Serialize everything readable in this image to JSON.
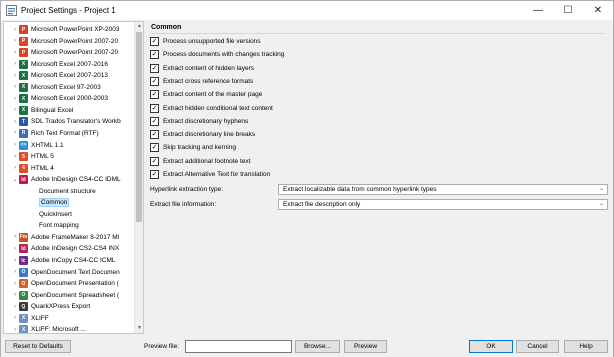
{
  "window": {
    "title": "Project Settings - Project 1",
    "controls": [
      "—",
      "☐",
      "✕"
    ]
  },
  "tree": {
    "items": [
      {
        "label": "Microsoft PowerPoint XP-2003",
        "icon": "P",
        "color": "#d24726",
        "level": 1,
        "exp": "›"
      },
      {
        "label": "Microsoft PowerPoint 2007-20",
        "icon": "P",
        "color": "#d24726",
        "level": 1,
        "exp": "›"
      },
      {
        "label": "Microsoft PowerPoint 2007-20",
        "icon": "P",
        "color": "#d24726",
        "level": 1,
        "exp": "›"
      },
      {
        "label": "Microsoft Excel 2007-2016",
        "icon": "X",
        "color": "#1d7044",
        "level": 1,
        "exp": "›"
      },
      {
        "label": "Microsoft Excel 2007-2013",
        "icon": "X",
        "color": "#1d7044",
        "level": 1,
        "exp": "›"
      },
      {
        "label": "Microsoft Excel 97-2003",
        "icon": "X",
        "color": "#1d7044",
        "level": 1,
        "exp": "›"
      },
      {
        "label": "Microsoft Excel 2000-2003",
        "icon": "X",
        "color": "#1d7044",
        "level": 1,
        "exp": "›"
      },
      {
        "label": "Bilingual Excel",
        "icon": "X",
        "color": "#1d7044",
        "level": 1,
        "exp": "›"
      },
      {
        "label": "SDL Trados Translator's Workb",
        "icon": "T",
        "color": "#2a5aa6",
        "level": 1,
        "exp": "›"
      },
      {
        "label": "Rich Text Format (RTF)",
        "icon": "R",
        "color": "#3d6fb4",
        "level": 1,
        "exp": "›"
      },
      {
        "label": "XHTML 1.1",
        "icon": "<>",
        "color": "#2f8fd8",
        "level": 1,
        "exp": "›"
      },
      {
        "label": "HTML 5",
        "icon": "5",
        "color": "#e44d26",
        "level": 1,
        "exp": "›"
      },
      {
        "label": "HTML 4",
        "icon": "4",
        "color": "#e44d26",
        "level": 1,
        "exp": "›"
      },
      {
        "label": "Adobe InDesign CS4-CC IDML",
        "icon": "Id",
        "color": "#c2185b",
        "level": 1,
        "exp": "⌄"
      },
      {
        "label": "Document structure",
        "icon": "",
        "color": "",
        "level": 2,
        "exp": ""
      },
      {
        "label": "Common",
        "icon": "",
        "color": "",
        "level": 2,
        "exp": "",
        "selected": true
      },
      {
        "label": "QuickInsert",
        "icon": "",
        "color": "",
        "level": 2,
        "exp": ""
      },
      {
        "label": "Font mapping",
        "icon": "",
        "color": "",
        "level": 2,
        "exp": ""
      },
      {
        "label": "Adobe FrameMaker 8-2017 MI",
        "icon": "Fm",
        "color": "#c9521f",
        "level": 1,
        "exp": "›"
      },
      {
        "label": "Adobe InDesign CS2-CS4 INX",
        "icon": "Id",
        "color": "#b5235c",
        "level": 1,
        "exp": "›"
      },
      {
        "label": "Adobe InCopy CS4-CC ICML",
        "icon": "Ic",
        "color": "#6f2b8a",
        "level": 1,
        "exp": "›"
      },
      {
        "label": "OpenDocument Text Documen",
        "icon": "O",
        "color": "#3b7ac6",
        "level": 1,
        "exp": "›"
      },
      {
        "label": "OpenDocument Presentation (",
        "icon": "O",
        "color": "#d3622a",
        "level": 1,
        "exp": "›"
      },
      {
        "label": "OpenDocument Spreadsheet (",
        "icon": "O",
        "color": "#2e8b3f",
        "level": 1,
        "exp": "›"
      },
      {
        "label": "QuarkXPress Export",
        "icon": "Q",
        "color": "#3c3c3c",
        "level": 1,
        "exp": "›"
      },
      {
        "label": "XLIFF",
        "icon": "X",
        "color": "#6f8fbf",
        "level": 1,
        "exp": "›"
      },
      {
        "label": "XLIFF: Microsoft ...",
        "icon": "X",
        "color": "#6f8fbf",
        "level": 1,
        "exp": "›"
      }
    ]
  },
  "panel": {
    "heading": "Common",
    "checkboxes": [
      {
        "label": "Process unsupported file versions",
        "checked": true
      },
      {
        "label": "Process documents with changes tracking",
        "checked": true
      },
      {
        "label": "Extract content of hidden layers",
        "checked": true
      },
      {
        "label": "Extract cross reference formats",
        "checked": true
      },
      {
        "label": "Extract content of the master page",
        "checked": true
      },
      {
        "label": "Extract hidden conditional text content",
        "checked": true
      },
      {
        "label": "Extract discretionary hyphens",
        "checked": true
      },
      {
        "label": "Extract discretionary line breaks",
        "checked": true
      },
      {
        "label": "Skip tracking and kerning",
        "checked": true
      },
      {
        "label": "Extract additional footnote text",
        "checked": true
      },
      {
        "label": "Extract Alternative Text for translation",
        "checked": true
      }
    ],
    "hyperlink_label": "Hyperlink extraction type:",
    "hyperlink_value": "Extract localizable data from common hyperlink types",
    "fileinfo_label": "Extract file information:",
    "fileinfo_value": "Extract file description only"
  },
  "bottom": {
    "reset_label": "Reset to Defaults",
    "preview_file_label": "Preview file:",
    "preview_file_value": "",
    "browse_label": "Browse...",
    "preview_label": "Preview",
    "ok_label": "OK",
    "cancel_label": "Cancel",
    "help_label": "Help"
  }
}
